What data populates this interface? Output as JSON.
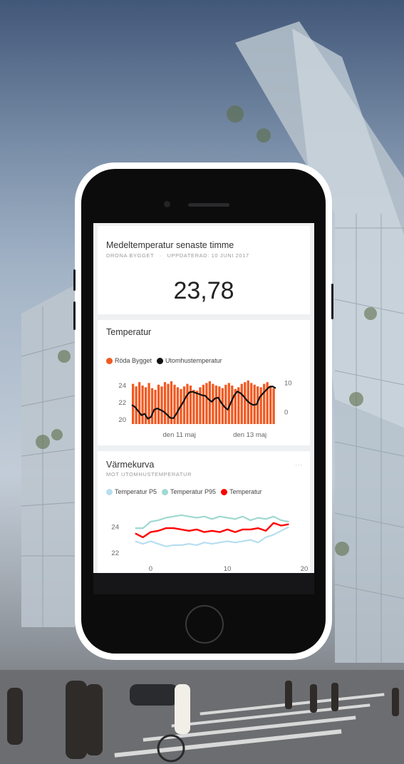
{
  "kpi_card": {
    "title": "Medeltemperatur senaste timme",
    "subtitle_source": "DRONA BYGGET",
    "subtitle_sep": "·",
    "subtitle_updated": "UPPDATERAD: 10 JUNI 2017",
    "value": "23,78"
  },
  "temp_card": {
    "title": "Temperatur",
    "legend": [
      {
        "label": "Röda Bygget",
        "color": "#f15a22"
      },
      {
        "label": "Utomhustemperatur",
        "color": "#111111"
      }
    ]
  },
  "curve_card": {
    "title": "Värmekurva",
    "subtitle": "MOT UTOMHUSTEMPERATUR",
    "more": "...",
    "legend": [
      {
        "label": "Temperatur P5",
        "color": "#b7def0"
      },
      {
        "label": "Temperatur P95",
        "color": "#9fd9d0"
      },
      {
        "label": "Temperatur",
        "color": "#ff0000"
      }
    ]
  },
  "chart_data": [
    {
      "type": "bar",
      "title": "Temperatur",
      "series": [
        {
          "name": "Röda Bygget",
          "type": "bar",
          "axis": "left",
          "values": [
            24.2,
            23.9,
            24.4,
            24.0,
            23.8,
            24.3,
            23.7,
            23.5,
            24.1,
            23.9,
            24.4,
            24.2,
            24.5,
            24.1,
            23.8,
            23.6,
            23.9,
            24.2,
            24.0,
            23.5,
            23.4,
            23.8,
            24.1,
            24.3,
            24.5,
            24.2,
            24.0,
            23.9,
            23.7,
            24.1,
            24.3,
            24.0,
            23.6,
            23.8,
            24.2,
            24.4,
            24.6,
            24.3,
            24.1,
            23.9,
            23.8,
            24.2,
            24.4,
            24.0,
            23.7
          ]
        },
        {
          "name": "Utomhustemperatur",
          "type": "line",
          "axis": "right",
          "values": [
            2.5,
            1.8,
            0.4,
            -1.0,
            -0.5,
            -2.2,
            -1.6,
            0.9,
            1.3,
            0.8,
            0.2,
            -0.8,
            -1.9,
            -2.0,
            -0.4,
            1.6,
            3.3,
            5.4,
            6.8,
            7.0,
            6.6,
            6.2,
            5.8,
            5.6,
            4.4,
            3.6,
            4.7,
            5.0,
            3.2,
            1.8,
            0.9,
            3.4,
            5.7,
            7.1,
            6.5,
            5.4,
            4.0,
            3.0,
            2.5,
            2.7,
            5.2,
            6.4,
            7.6,
            8.6,
            8.8,
            8.2
          ]
        }
      ],
      "y_left_ticks": [
        "24",
        "22",
        "20"
      ],
      "y_left_range": [
        19.5,
        25
      ],
      "y_right_ticks": [
        "10",
        "0"
      ],
      "y_right_range": [
        -4,
        12
      ],
      "x_tick_labels": [
        "den 11 maj",
        "den 13 maj"
      ]
    },
    {
      "type": "line",
      "title": "Värmekurva",
      "x": [
        -2,
        -1,
        0,
        1,
        2,
        3,
        4,
        5,
        6,
        7,
        8,
        9,
        10,
        11,
        12,
        13,
        14,
        15,
        16,
        17,
        18
      ],
      "series": [
        {
          "name": "Temperatur P5",
          "values": [
            22.9,
            22.7,
            22.9,
            22.7,
            22.5,
            22.6,
            22.6,
            22.7,
            22.6,
            22.8,
            22.7,
            22.8,
            22.9,
            22.8,
            22.9,
            23.0,
            22.8,
            23.2,
            23.4,
            23.7,
            24.0
          ]
        },
        {
          "name": "Temperatur P95",
          "values": [
            23.9,
            23.9,
            24.4,
            24.5,
            24.7,
            24.8,
            24.9,
            24.8,
            24.7,
            24.8,
            24.6,
            24.8,
            24.7,
            24.6,
            24.8,
            24.5,
            24.7,
            24.6,
            24.8,
            24.5,
            24.4
          ]
        },
        {
          "name": "Temperatur",
          "values": [
            23.5,
            23.2,
            23.6,
            23.7,
            23.9,
            23.9,
            23.8,
            23.7,
            23.8,
            23.6,
            23.7,
            23.6,
            23.8,
            23.6,
            23.8,
            23.8,
            23.9,
            23.7,
            24.3,
            24.1,
            24.2
          ]
        }
      ],
      "y_ticks": [
        "24",
        "22"
      ],
      "y_range": [
        21.5,
        25
      ],
      "x_ticks": [
        "0",
        "10",
        "20"
      ],
      "x_range": [
        -3,
        20
      ]
    }
  ]
}
